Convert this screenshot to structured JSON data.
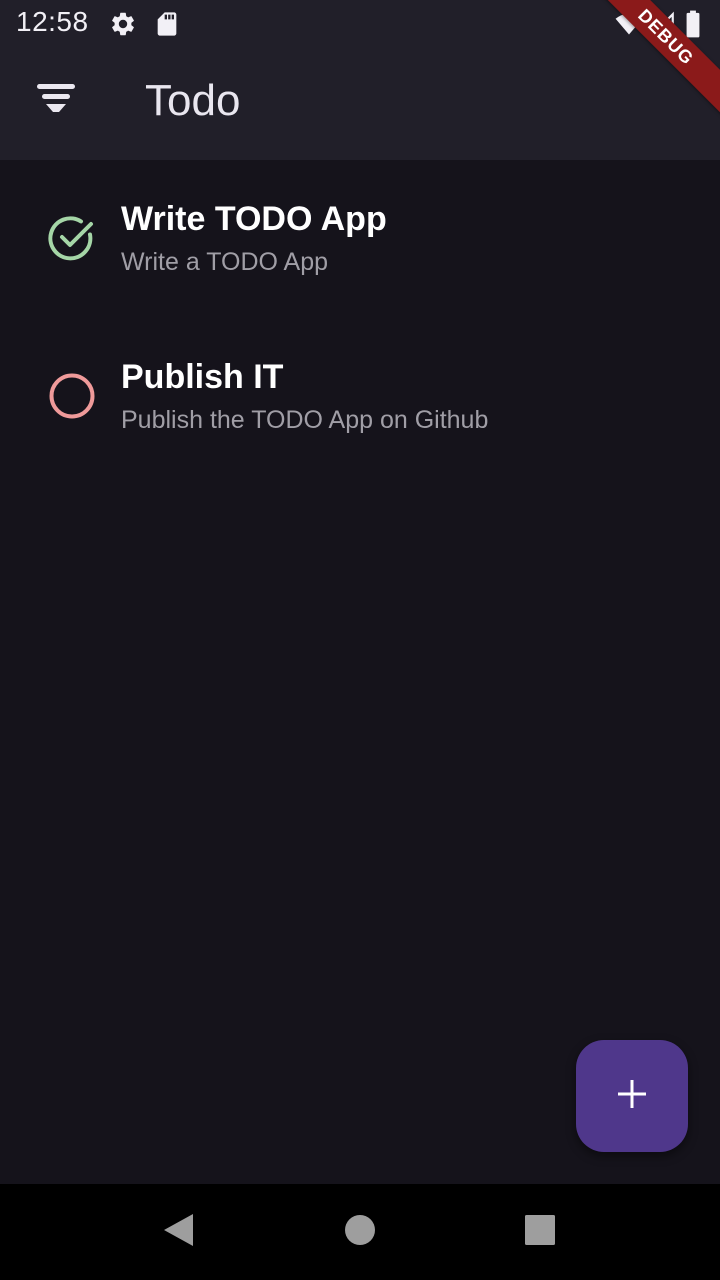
{
  "status_bar": {
    "time": "12:58",
    "icons": [
      "gear-icon",
      "sd-card-icon",
      "wifi-icon",
      "signal-icon",
      "battery-icon"
    ]
  },
  "app_bar": {
    "title": "Todo",
    "menu_icon": "filter-icon"
  },
  "debug_banner": {
    "label": "DEBUG",
    "color": "#8b1a1a"
  },
  "todos": [
    {
      "title": "Write TODO App",
      "subtitle": "Write a TODO App",
      "status": "done",
      "status_icon": "check-circle-icon",
      "status_color": "#a5d6a7"
    },
    {
      "title": "Publish IT",
      "subtitle": "Publish the TODO App on Github",
      "status": "pending",
      "status_icon": "empty-circle-icon",
      "status_color": "#ef9a9a"
    }
  ],
  "fab": {
    "icon": "plus-icon",
    "color": "#4f378b"
  },
  "nav_bar": {
    "buttons": [
      "back-icon",
      "home-icon",
      "recents-icon"
    ]
  },
  "colors": {
    "background": "#15131b",
    "app_bar": "#211f29",
    "subtitle_text": "#a09ea6"
  }
}
